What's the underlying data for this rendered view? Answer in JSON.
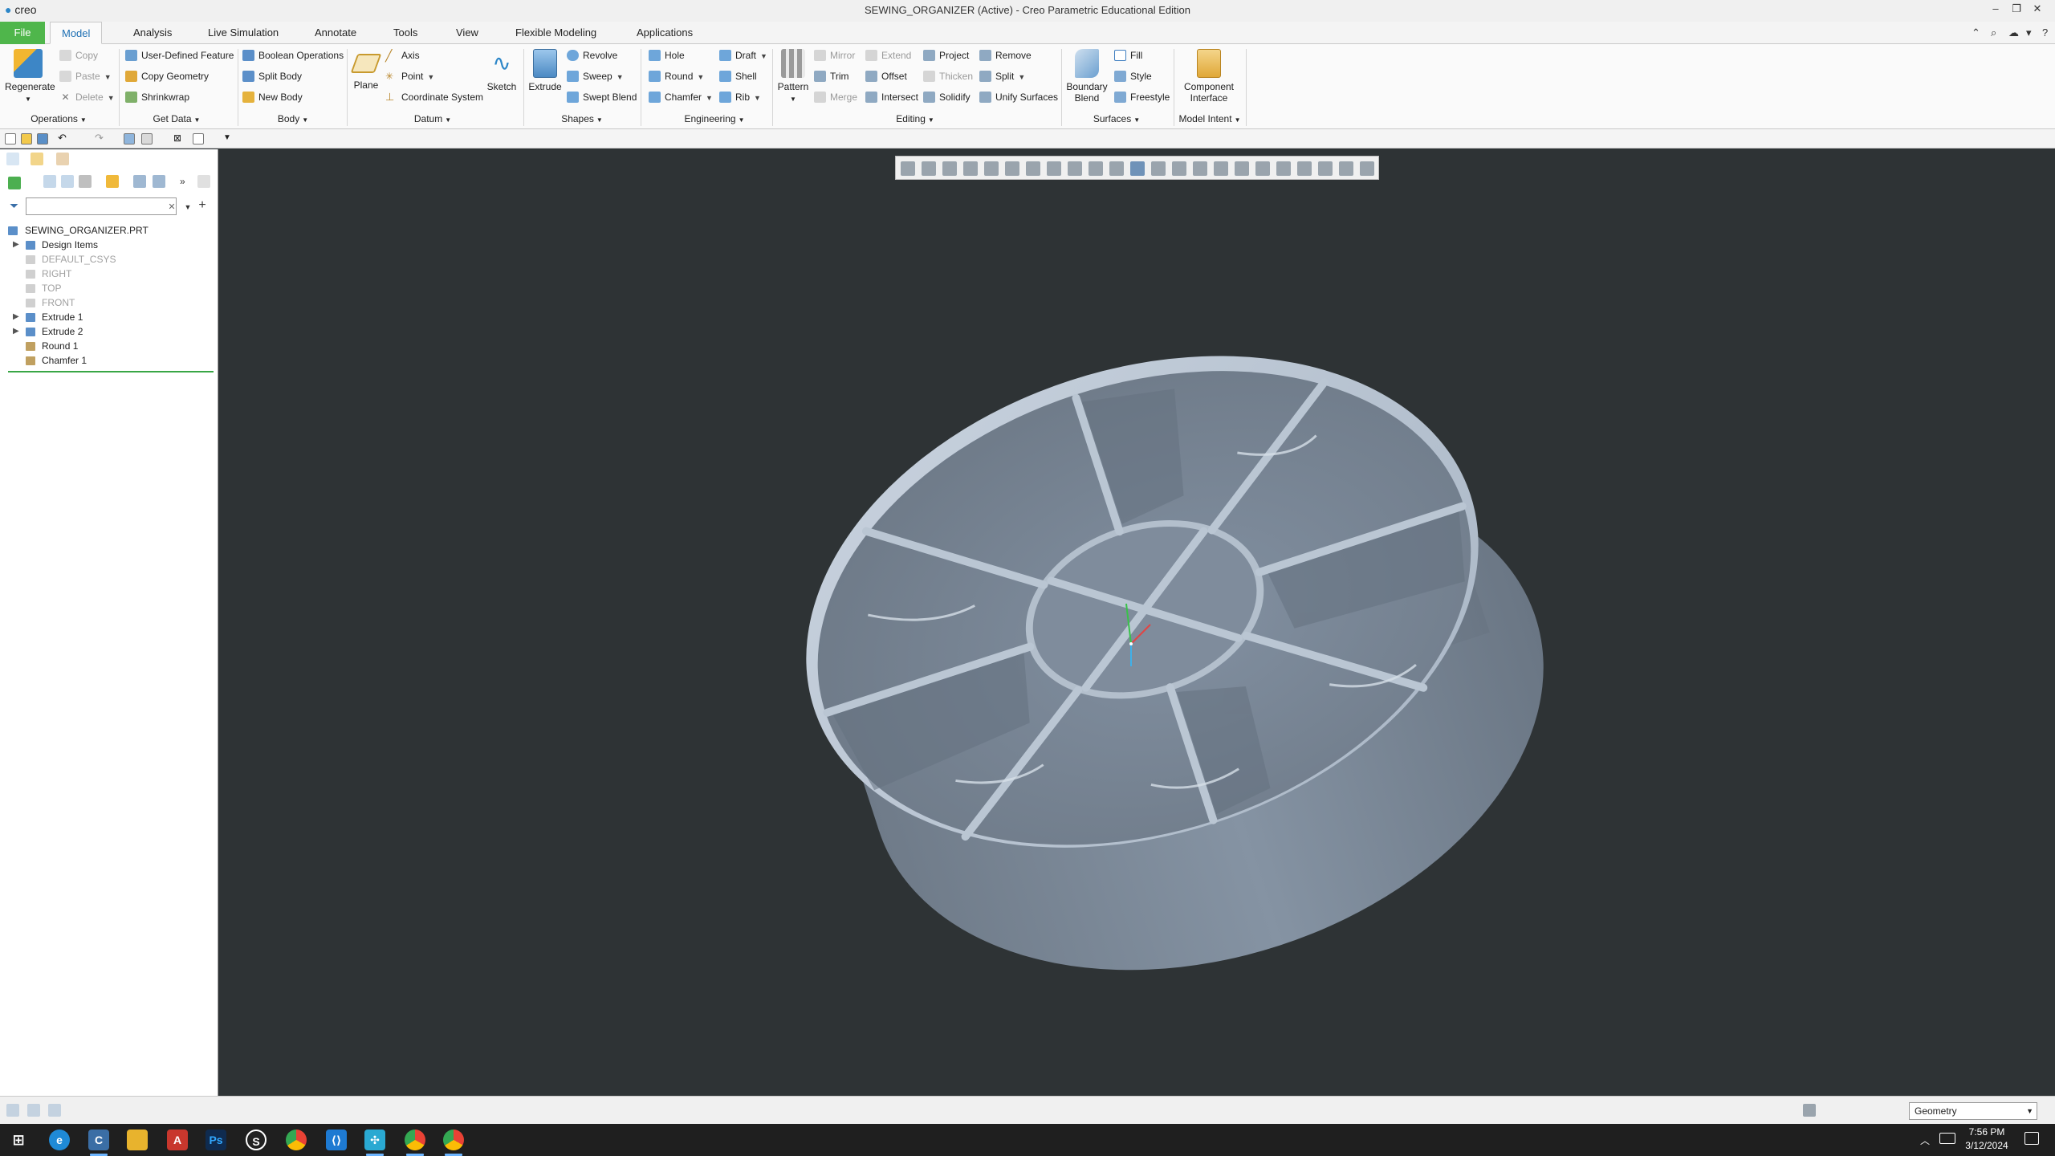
{
  "window": {
    "app_logo": "creo",
    "title": "SEWING_ORGANIZER (Active) - Creo Parametric Educational Edition",
    "controls": [
      "minimize-icon",
      "restore-icon",
      "close-icon"
    ]
  },
  "tabs": {
    "file": "File",
    "model": "Model",
    "analysis": "Analysis",
    "live_simulation": "Live Simulation",
    "annotate": "Annotate",
    "tools": "Tools",
    "view": "View",
    "flexible_modeling": "Flexible Modeling",
    "applications": "Applications"
  },
  "ribbon": {
    "operations": {
      "regenerate": "Regenerate",
      "copy": "Copy",
      "paste": "Paste",
      "delete": "Delete",
      "group": "Operations"
    },
    "get_data": {
      "udf": "User-Defined Feature",
      "copy_geometry": "Copy Geometry",
      "shrinkwrap": "Shrinkwrap",
      "group": "Get Data"
    },
    "body": {
      "boolean": "Boolean Operations",
      "split_body": "Split Body",
      "new_body": "New Body",
      "group": "Body"
    },
    "datum": {
      "plane": "Plane",
      "axis": "Axis",
      "point": "Point",
      "csys": "Coordinate System",
      "sketch": "Sketch",
      "group": "Datum"
    },
    "shapes": {
      "extrude": "Extrude",
      "revolve": "Revolve",
      "sweep": "Sweep",
      "swept_blend": "Swept Blend",
      "group": "Shapes"
    },
    "engineering": {
      "hole": "Hole",
      "round": "Round",
      "chamfer": "Chamfer",
      "draft": "Draft",
      "shell": "Shell",
      "rib": "Rib",
      "group": "Engineering"
    },
    "editing": {
      "pattern": "Pattern",
      "mirror": "Mirror",
      "trim": "Trim",
      "merge": "Merge",
      "extend": "Extend",
      "offset": "Offset",
      "intersect": "Intersect",
      "project": "Project",
      "thicken": "Thicken",
      "solidify": "Solidify",
      "remove": "Remove",
      "split": "Split",
      "unify": "Unify Surfaces",
      "group": "Editing"
    },
    "surfaces": {
      "boundary_line1": "Boundary",
      "boundary_line2": "Blend",
      "fill": "Fill",
      "style": "Style",
      "freestyle": "Freestyle",
      "group": "Surfaces"
    },
    "model_intent": {
      "component_line1": "Component",
      "component_line2": "Interface",
      "group": "Model Intent"
    }
  },
  "model_tree": {
    "root": "SEWING_ORGANIZER.PRT",
    "items": [
      {
        "label": "Design Items",
        "expandable": true,
        "dim": false
      },
      {
        "label": "DEFAULT_CSYS",
        "expandable": false,
        "dim": true
      },
      {
        "label": "RIGHT",
        "expandable": false,
        "dim": true
      },
      {
        "label": "TOP",
        "expandable": false,
        "dim": true
      },
      {
        "label": "FRONT",
        "expandable": false,
        "dim": true
      },
      {
        "label": "Extrude 1",
        "expandable": true,
        "dim": false
      },
      {
        "label": "Extrude 2",
        "expandable": true,
        "dim": false
      },
      {
        "label": "Round 1",
        "expandable": false,
        "dim": false
      },
      {
        "label": "Chamfer 1",
        "expandable": false,
        "dim": false
      }
    ],
    "search_placeholder": ""
  },
  "status": {
    "selection_filter": "Geometry"
  },
  "taskbar": {
    "time": "7:56 PM",
    "date": "3/12/2024",
    "apps": [
      "windows-start-icon",
      "edge-icon",
      "creo-icon",
      "file-explorer-icon",
      "acrobat-icon",
      "photoshop-icon",
      "steam-icon",
      "chrome-icon",
      "vscode-icon",
      "network-app-icon",
      "chrome-icon",
      "chrome-icon"
    ]
  },
  "colors": {
    "file_tab": "#4fb64b",
    "active_tab_text": "#1d6fb3",
    "viewport_bg": "#2e3335",
    "model_surface": "#8d9bad",
    "insert_line": "#39a646"
  }
}
